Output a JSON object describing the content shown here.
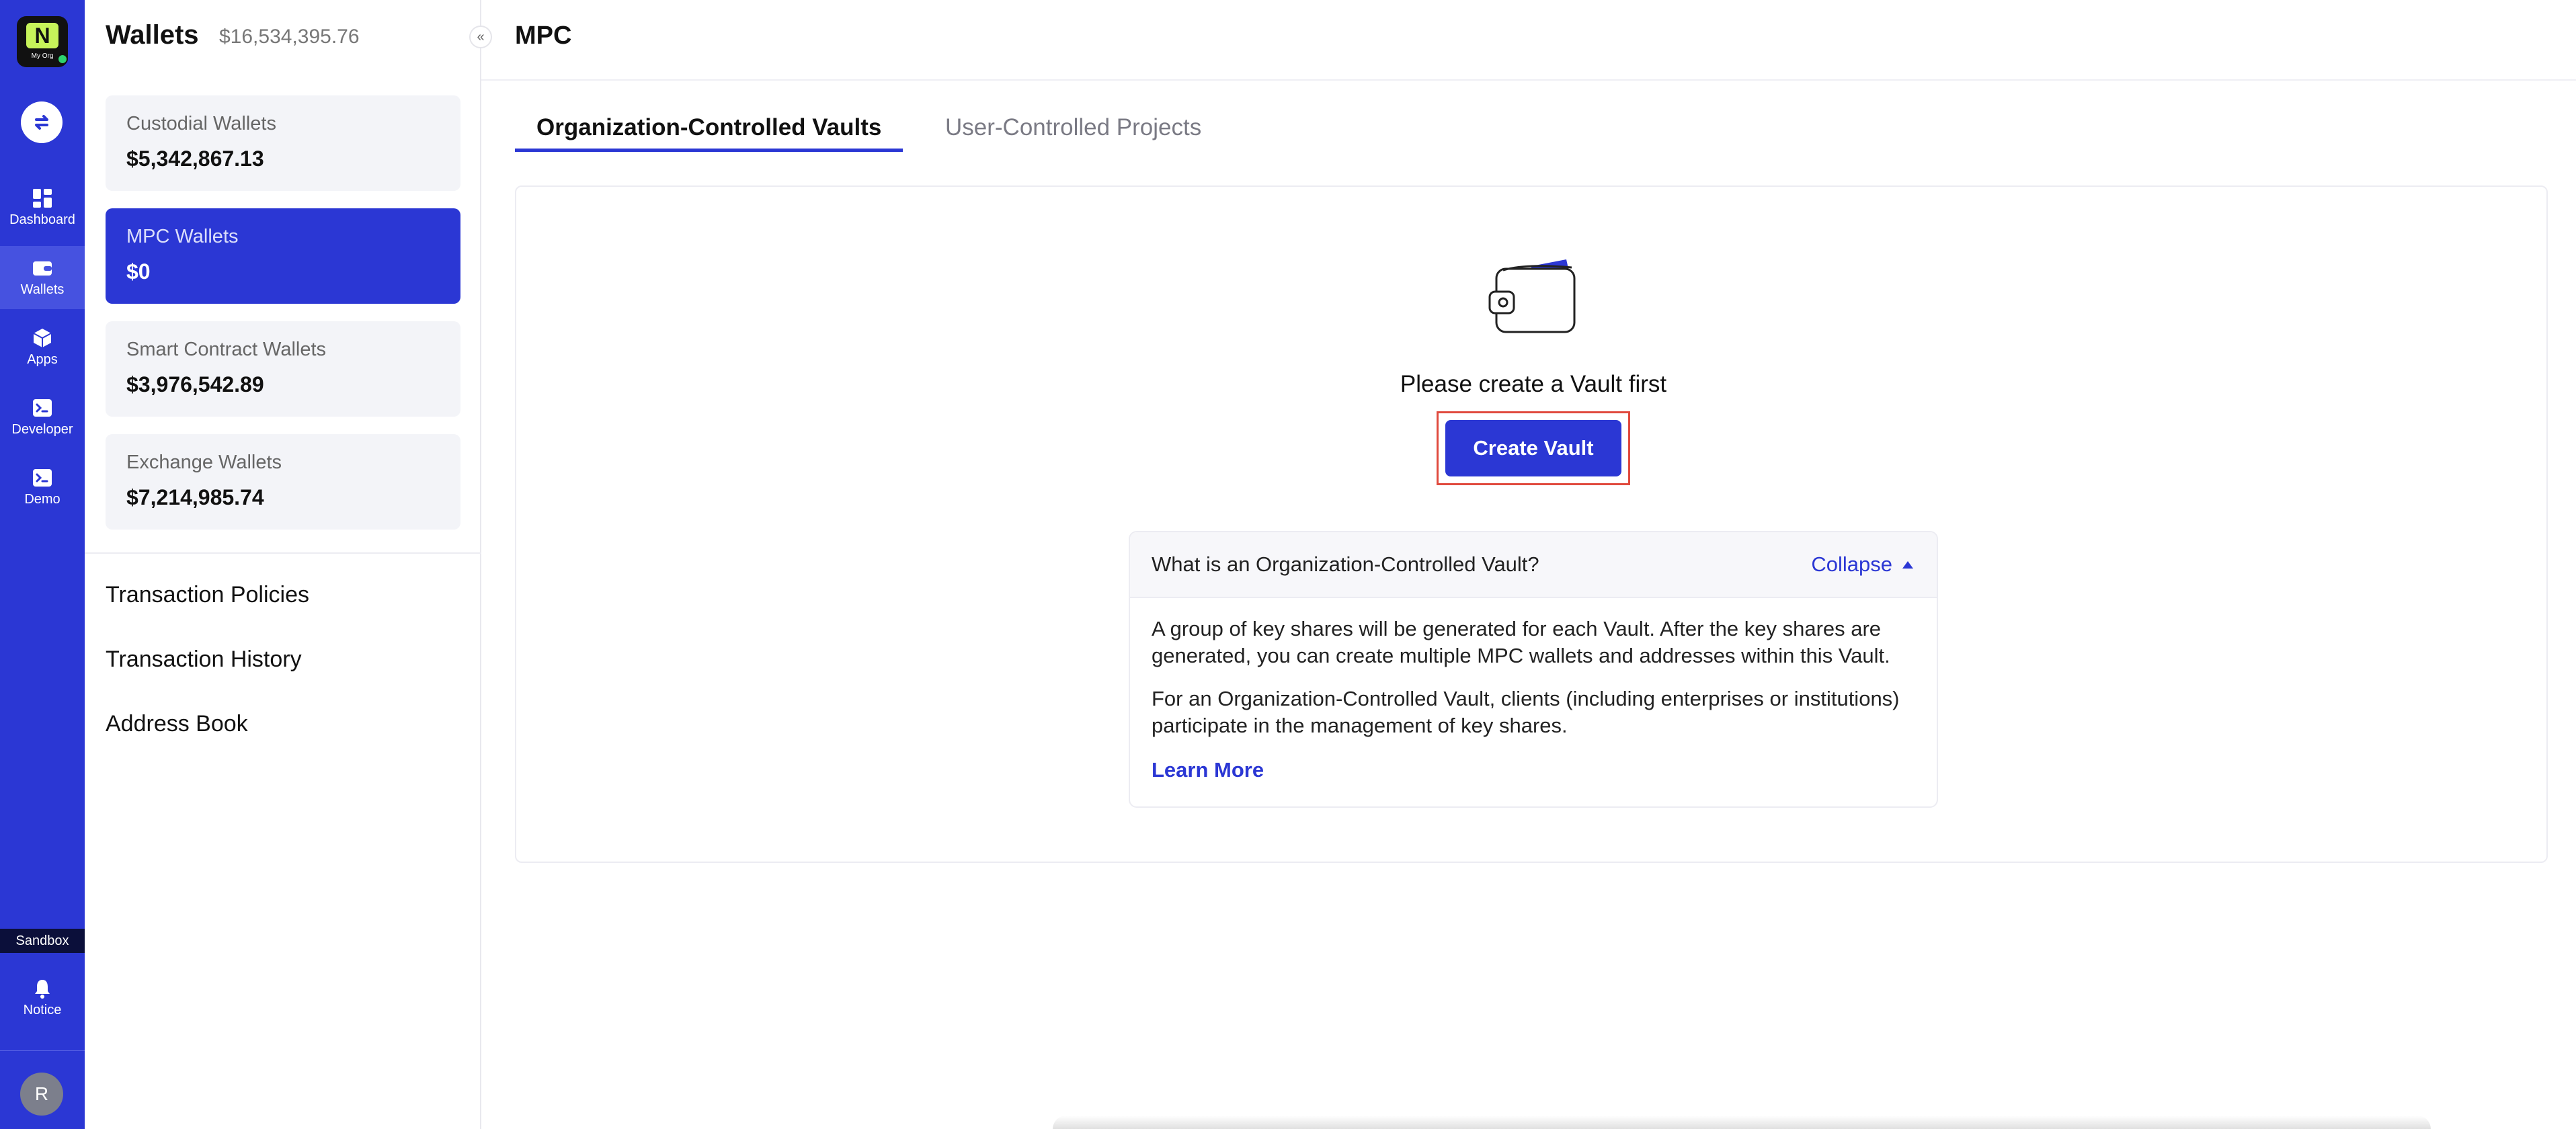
{
  "rail": {
    "logo_text": "My Org",
    "items": [
      {
        "label": "Dashboard",
        "icon": "dashboard-icon"
      },
      {
        "label": "Wallets",
        "icon": "wallet-icon"
      },
      {
        "label": "Apps",
        "icon": "apps-cube-icon"
      },
      {
        "label": "Developer",
        "icon": "terminal-icon"
      },
      {
        "label": "Demo",
        "icon": "terminal-icon"
      }
    ],
    "sandbox_label": "Sandbox",
    "notice_label": "Notice",
    "avatar_initial": "R",
    "active_index": 1
  },
  "sidebar": {
    "title": "Wallets",
    "total": "$16,534,395.76",
    "cards": [
      {
        "name": "Custodial Wallets",
        "value": "$5,342,867.13"
      },
      {
        "name": "MPC Wallets",
        "value": "$0"
      },
      {
        "name": "Smart Contract Wallets",
        "value": "$3,976,542.89"
      },
      {
        "name": "Exchange Wallets",
        "value": "$7,214,985.74"
      }
    ],
    "active_card_index": 1,
    "links": [
      "Transaction Policies",
      "Transaction History",
      "Address Book"
    ],
    "collapse_glyph": "«"
  },
  "main": {
    "page_title": "MPC",
    "tabs": [
      {
        "label": "Organization-Controlled Vaults",
        "active": true
      },
      {
        "label": "User-Controlled Projects",
        "active": false
      }
    ],
    "empty_message": "Please create a Vault first",
    "create_button": "Create Vault",
    "faq": {
      "question": "What is an Organization-Controlled Vault?",
      "toggle_label": "Collapse",
      "paragraph1": "A group of key shares will be generated for each Vault. After the key shares are generated, you can create multiple MPC wallets and addresses within this Vault.",
      "paragraph2": "For an Organization-Controlled Vault, clients (including enterprises or institutions) participate in the management of key shares.",
      "learn_more": "Learn More"
    }
  },
  "colors": {
    "brand": "#2b37d4",
    "highlight_border": "#e04a3e",
    "logo_accent": "#c7f35a",
    "status_online": "#2dd36f"
  }
}
